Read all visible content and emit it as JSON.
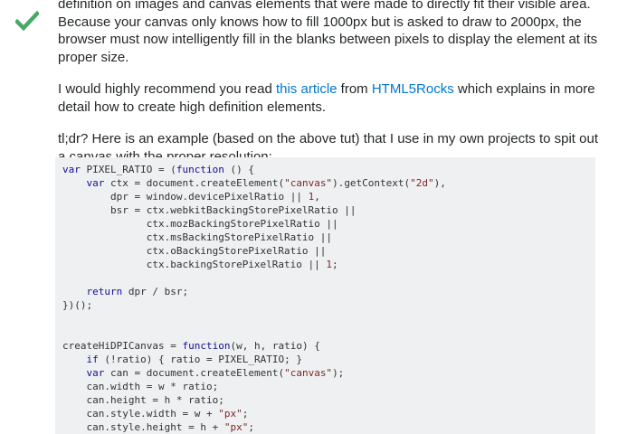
{
  "answer": {
    "accepted": true,
    "paragraphs": {
      "p1_text": "definition on images and canvas elements that were made to directly fit their visible area. Because your canvas only knows how to fill 1000px but is asked to draw to 2000px, the browser must now intelligently fill in the blanks between pixels to display the element at its proper size.",
      "p2_before": "I would highly recommend you read ",
      "p2_link1": "this article",
      "p2_middle": " from ",
      "p2_link2": "HTML5Rocks",
      "p2_after": " which explains in more detail how to create high definition elements.",
      "p3_text": "tl;dr? Here is an example (based on the above tut) that I use in my own projects to spit out a canvas with the proper resolution:"
    },
    "code": {
      "lines": [
        "var PIXEL_RATIO = (function () {",
        "    var ctx = document.createElement(\"canvas\").getContext(\"2d\"),",
        "        dpr = window.devicePixelRatio || 1,",
        "        bsr = ctx.webkitBackingStorePixelRatio ||",
        "              ctx.mozBackingStorePixelRatio ||",
        "              ctx.msBackingStorePixelRatio ||",
        "              ctx.oBackingStorePixelRatio ||",
        "              ctx.backingStorePixelRatio || 1;",
        "",
        "    return dpr / bsr;",
        "})();",
        "",
        "",
        "createHiDPICanvas = function(w, h, ratio) {",
        "    if (!ratio) { ratio = PIXEL_RATIO; }",
        "    var can = document.createElement(\"canvas\");",
        "    can.width = w * ratio;",
        "    can.height = h * ratio;",
        "    can.style.width = w + \"px\";",
        "    can.style.height = h + \"px\";"
      ]
    }
  },
  "colors": {
    "accepted_check": "#48a868",
    "link": "#0077cc",
    "code_background": "#eff0f1",
    "keyword": "#101094",
    "string": "#7d2727"
  },
  "icons": {
    "accepted": "checkmark-icon"
  }
}
